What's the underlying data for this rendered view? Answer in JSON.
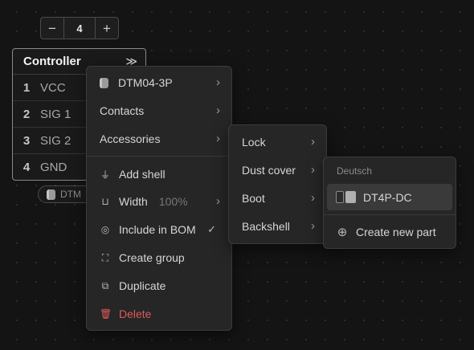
{
  "stepper": {
    "minus": "−",
    "value": "4",
    "plus": "+"
  },
  "node": {
    "title": "Controller",
    "collapse_icon": "≫",
    "pins": [
      {
        "num": "1",
        "name": "VCC"
      },
      {
        "num": "2",
        "name": "SIG 1"
      },
      {
        "num": "3",
        "name": "SIG 2"
      },
      {
        "num": "4",
        "name": "GND"
      }
    ],
    "tag_label": "DTM"
  },
  "context_menu": {
    "part_label": "DTM04-3P",
    "contacts": "Contacts",
    "accessories": "Accessories",
    "add_shell": "Add shell",
    "width": "Width",
    "width_value": "100%",
    "include_in_bom": "Include in BOM",
    "include_in_bom_checked": true,
    "create_group": "Create group",
    "duplicate": "Duplicate",
    "delete": "Delete"
  },
  "accessories_menu": {
    "lock": "Lock",
    "dust_cover": "Dust cover",
    "boot": "Boot",
    "backshell": "Backshell"
  },
  "dust_cover_menu": {
    "section": "Deutsch",
    "part": "DT4P-DC",
    "create_new": "Create new part"
  },
  "colors": {
    "danger": "#e05a5a",
    "background": "#141414",
    "menu_bg": "#262626"
  }
}
